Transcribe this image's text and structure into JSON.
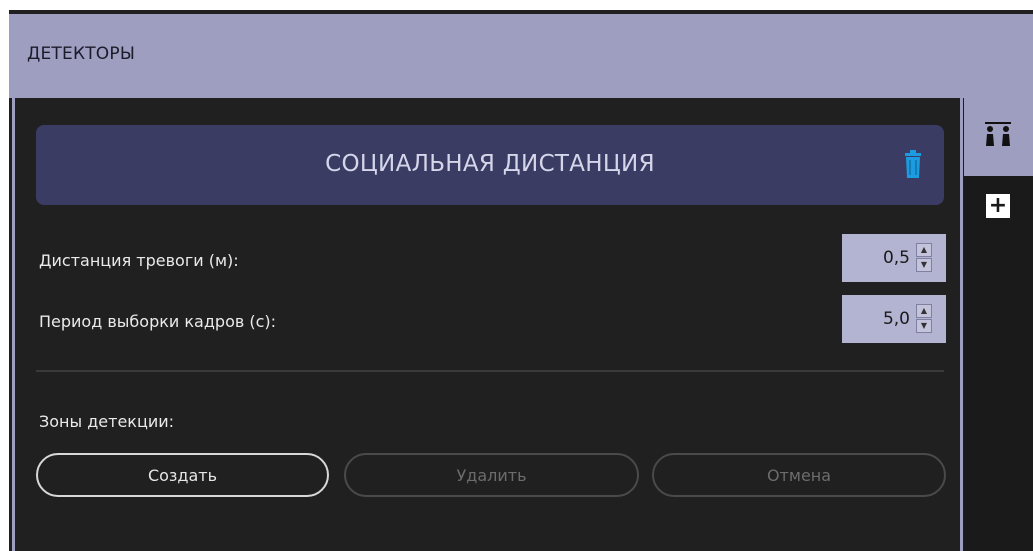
{
  "header": {
    "title": "ДЕТЕКТОРЫ"
  },
  "detector": {
    "title": "СОЦИАЛЬНАЯ ДИСТАНЦИЯ",
    "delete_icon": "trash-icon",
    "accent_color": "#3b3c63"
  },
  "fields": {
    "alarm_distance": {
      "label": "Дистанция тревоги (м):",
      "value": "0,5"
    },
    "sampling_period": {
      "label": "Период выборки кадров (с):",
      "value": "5,0"
    }
  },
  "zones": {
    "label": "Зоны детекции:",
    "create": "Создать",
    "delete": "Удалить",
    "cancel": "Отмена"
  },
  "side_tabs": [
    {
      "icon": "people-distance-icon"
    },
    {
      "icon": "plus-icon"
    }
  ]
}
